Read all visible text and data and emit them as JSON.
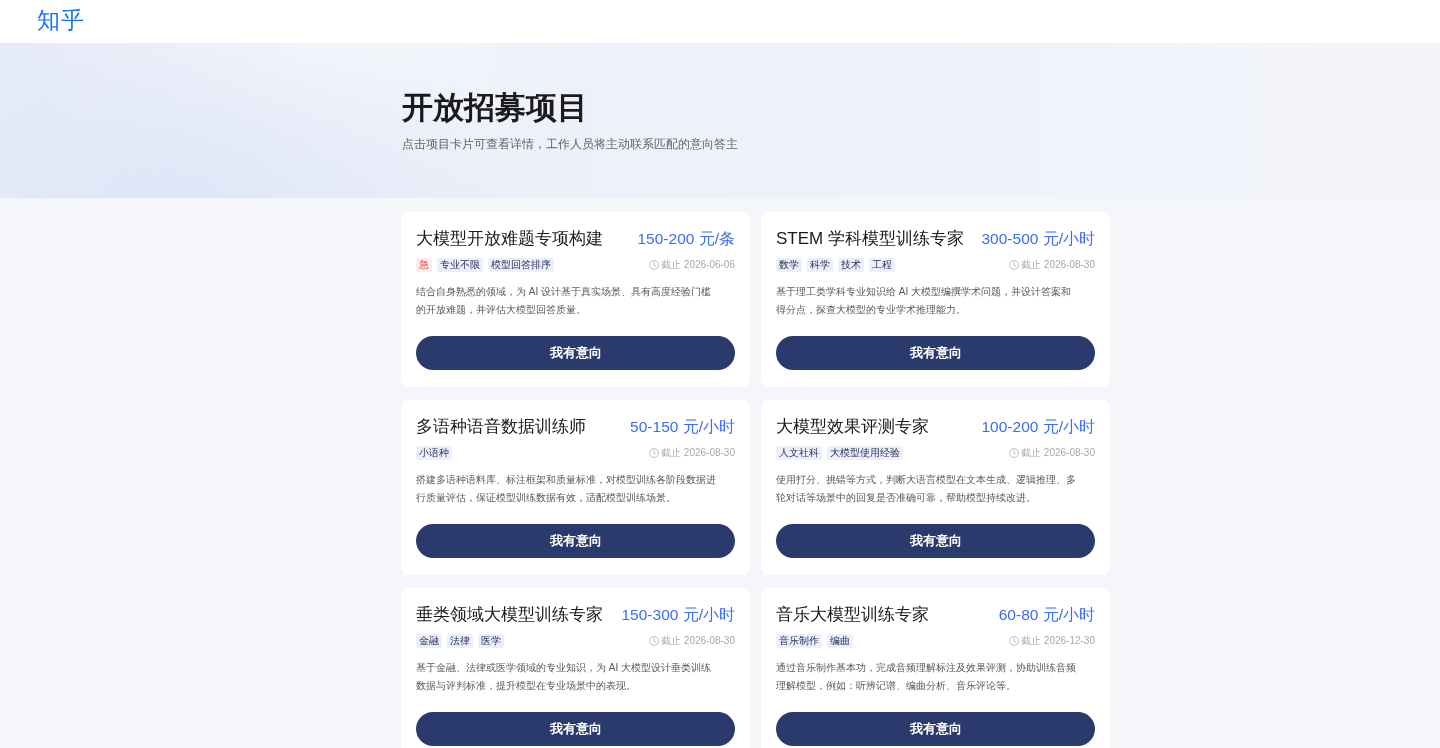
{
  "header": {
    "logo": "知乎"
  },
  "hero": {
    "title": "开放招募项目",
    "subtitle": "点击项目卡片可查看详情，工作人员将主动联系匹配的意向答主"
  },
  "projects": [
    {
      "title": "大模型开放难题专项构建",
      "pay": "150-200 元/条",
      "tags": [
        {
          "label": "急",
          "kind": "urgent"
        },
        {
          "label": "专业不限",
          "kind": "topic"
        },
        {
          "label": "模型回答排序",
          "kind": "topic"
        }
      ],
      "deadline": "截止 2026-06-06",
      "description": "结合自身熟悉的领域，为 AI 设计基于真实场景、具有高度经验门槛的开放难题，并评估大模型回答质量。",
      "button": "我有意向"
    },
    {
      "title": "STEM 学科模型训练专家",
      "pay": "300-500 元/小时",
      "tags": [
        {
          "label": "数学",
          "kind": "topic"
        },
        {
          "label": "科学",
          "kind": "topic"
        },
        {
          "label": "技术",
          "kind": "topic"
        },
        {
          "label": "工程",
          "kind": "topic"
        }
      ],
      "deadline": "截止 2026-08-30",
      "description": "基于理工类学科专业知识给 AI 大模型编撰学术问题，并设计答案和得分点，探查大模型的专业学术推理能力。",
      "button": "我有意向"
    },
    {
      "title": "多语种语音数据训练师",
      "pay": "50-150 元/小时",
      "tags": [
        {
          "label": "小语种",
          "kind": "topic"
        }
      ],
      "deadline": "截止 2026-08-30",
      "description": "搭建多语种语料库、标注框架和质量标准，对模型训练各阶段数据进行质量评估，保证模型训练数据有效，适配模型训练场景。",
      "button": "我有意向"
    },
    {
      "title": "大模型效果评测专家",
      "pay": "100-200 元/小时",
      "tags": [
        {
          "label": "人文社科",
          "kind": "topic"
        },
        {
          "label": "大模型使用经验",
          "kind": "topic"
        }
      ],
      "deadline": "截止 2026-08-30",
      "description": "使用打分、挑错等方式，判断大语言模型在文本生成、逻辑推理、多轮对话等场景中的回复是否准确可靠，帮助模型持续改进。",
      "button": "我有意向"
    },
    {
      "title": "垂类领域大模型训练专家",
      "pay": "150-300 元/小时",
      "tags": [
        {
          "label": "金融",
          "kind": "topic"
        },
        {
          "label": "法律",
          "kind": "topic"
        },
        {
          "label": "医学",
          "kind": "topic"
        }
      ],
      "deadline": "截止 2026-08-30",
      "description": "基于金融、法律或医学领域的专业知识，为 AI 大模型设计垂类训练数据与评判标准，提升模型在专业场景中的表现。",
      "button": "我有意向"
    },
    {
      "title": "音乐大模型训练专家",
      "pay": "60-80 元/小时",
      "tags": [
        {
          "label": "音乐制作",
          "kind": "topic"
        },
        {
          "label": "编曲",
          "kind": "topic"
        }
      ],
      "deadline": "截止 2026-12-30",
      "description": "通过音乐制作基本功，完成音频理解标注及效果评测，协助训练音频理解模型，例如：听辨记谱、编曲分析、音乐评论等。",
      "button": "我有意向"
    }
  ]
}
